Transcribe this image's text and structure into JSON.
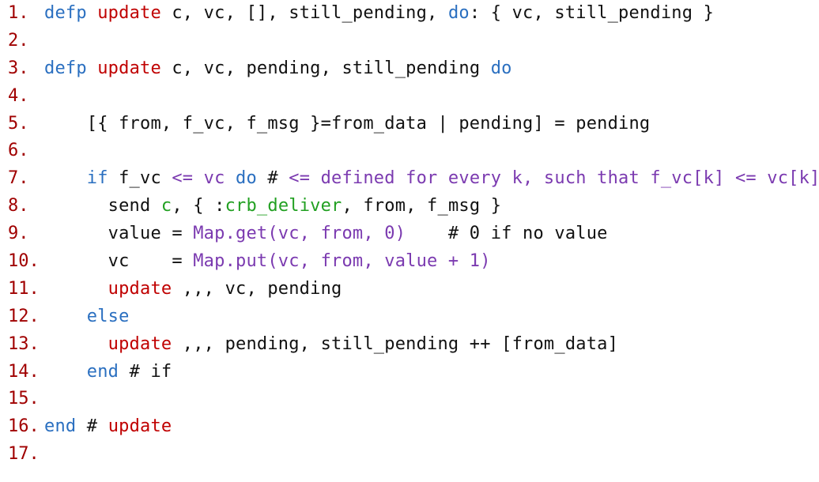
{
  "lines": [
    {
      "number": "1.",
      "tokens": [
        {
          "t": "defp",
          "c": "k"
        },
        {
          "t": " ",
          "c": "p"
        },
        {
          "t": "update",
          "c": "f"
        },
        {
          "t": " c, vc, [], still_pending, ",
          "c": "p"
        },
        {
          "t": "do",
          "c": "k"
        },
        {
          "t": ": { vc, still_pending }",
          "c": "p"
        }
      ]
    },
    {
      "number": "2.",
      "tokens": []
    },
    {
      "number": "3.",
      "tokens": [
        {
          "t": "defp",
          "c": "k"
        },
        {
          "t": " ",
          "c": "p"
        },
        {
          "t": "update",
          "c": "f"
        },
        {
          "t": " c, vc, pending, still_pending ",
          "c": "p"
        },
        {
          "t": "do",
          "c": "k"
        }
      ]
    },
    {
      "number": "4.",
      "tokens": []
    },
    {
      "number": "5.",
      "tokens": [
        {
          "t": "    [{ from, f_vc, f_msg }=from_data | pending] = pending",
          "c": "p"
        }
      ]
    },
    {
      "number": "6.",
      "tokens": []
    },
    {
      "number": "7.",
      "tokens": [
        {
          "t": "    ",
          "c": "p"
        },
        {
          "t": "if",
          "c": "k"
        },
        {
          "t": " f_vc ",
          "c": "p"
        },
        {
          "t": "<=",
          "c": "m"
        },
        {
          "t": " vc ",
          "c": "m"
        },
        {
          "t": "do",
          "c": "k"
        },
        {
          "t": " # ",
          "c": "p"
        },
        {
          "t": "<= defined for every k, such that f_vc[k] <= vc[k]",
          "c": "m"
        }
      ]
    },
    {
      "number": "8.",
      "tokens": [
        {
          "t": "      send ",
          "c": "p"
        },
        {
          "t": "c",
          "c": "a"
        },
        {
          "t": ", { :",
          "c": "p"
        },
        {
          "t": "crb_deliver",
          "c": "a"
        },
        {
          "t": ", from, f_msg }",
          "c": "p"
        }
      ]
    },
    {
      "number": "9.",
      "tokens": [
        {
          "t": "      value = ",
          "c": "p"
        },
        {
          "t": "Map.get(vc, from, 0)",
          "c": "m"
        },
        {
          "t": "    # 0 if no value",
          "c": "p"
        }
      ]
    },
    {
      "number": "10.",
      "tokens": [
        {
          "t": "      vc    = ",
          "c": "p"
        },
        {
          "t": "Map.put(vc, from, value + 1)",
          "c": "m"
        }
      ]
    },
    {
      "number": "11.",
      "tokens": [
        {
          "t": "      ",
          "c": "p"
        },
        {
          "t": "update",
          "c": "f"
        },
        {
          "t": " ,,, vc, pending",
          "c": "p"
        }
      ]
    },
    {
      "number": "12.",
      "tokens": [
        {
          "t": "    ",
          "c": "p"
        },
        {
          "t": "else",
          "c": "k"
        }
      ]
    },
    {
      "number": "13.",
      "tokens": [
        {
          "t": "      ",
          "c": "p"
        },
        {
          "t": "update",
          "c": "f"
        },
        {
          "t": " ,,, pending, still_pending ++ [from_data]",
          "c": "p"
        }
      ]
    },
    {
      "number": "14.",
      "tokens": [
        {
          "t": "    ",
          "c": "p"
        },
        {
          "t": "end",
          "c": "k"
        },
        {
          "t": " # if",
          "c": "p"
        }
      ]
    },
    {
      "number": "15.",
      "tokens": []
    },
    {
      "number": "16.",
      "tokens": [
        {
          "t": "end",
          "c": "k"
        },
        {
          "t": " # ",
          "c": "p"
        },
        {
          "t": "update",
          "c": "f"
        }
      ]
    },
    {
      "number": "17.",
      "tokens": []
    }
  ],
  "colors": {
    "keyword": "#2a6fc0",
    "function": "#c00000",
    "call": "#7b3ab0",
    "atom": "#22a022",
    "line_number": "#a00000",
    "text": "#111111"
  }
}
